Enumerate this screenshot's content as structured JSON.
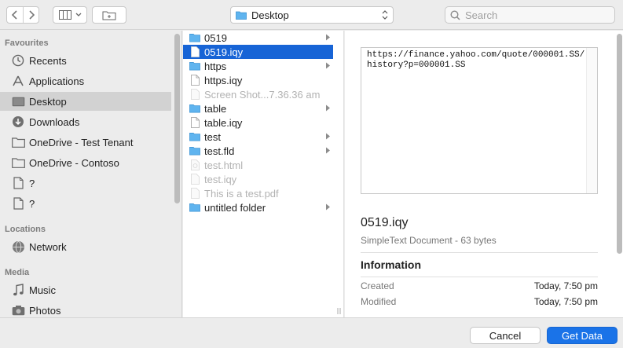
{
  "toolbar": {
    "location": "Desktop",
    "search_placeholder": "Search"
  },
  "sidebar": {
    "favourites_heading": "Favourites",
    "favourites": [
      {
        "label": "Recents",
        "icon": "clock-icon"
      },
      {
        "label": "Applications",
        "icon": "applications-icon"
      },
      {
        "label": "Desktop",
        "icon": "desktop-icon",
        "selected": true
      },
      {
        "label": "Downloads",
        "icon": "download-icon"
      },
      {
        "label": "OneDrive - Test Tenant",
        "icon": "folder-icon"
      },
      {
        "label": "OneDrive - Contoso",
        "icon": "folder-icon"
      },
      {
        "label": "?",
        "icon": "document-icon"
      },
      {
        "label": "?",
        "icon": "document-icon"
      }
    ],
    "locations_heading": "Locations",
    "locations": [
      {
        "label": "Network",
        "icon": "network-icon"
      }
    ],
    "media_heading": "Media",
    "media": [
      {
        "label": "Music",
        "icon": "music-icon"
      },
      {
        "label": "Photos",
        "icon": "camera-icon"
      }
    ]
  },
  "files": [
    {
      "name": "0519",
      "type": "folder",
      "enabled": true,
      "chevron": true
    },
    {
      "name": "0519.iqy",
      "type": "doc",
      "enabled": true,
      "selected": true
    },
    {
      "name": "https",
      "type": "folder",
      "enabled": true,
      "chevron": true
    },
    {
      "name": "https.iqy",
      "type": "doc",
      "enabled": true
    },
    {
      "name": "Screen Shot...7.36.36 am",
      "type": "doc",
      "enabled": false
    },
    {
      "name": "table",
      "type": "folder",
      "enabled": true,
      "chevron": true
    },
    {
      "name": "table.iqy",
      "type": "doc",
      "enabled": true
    },
    {
      "name": "test",
      "type": "folder",
      "enabled": true,
      "chevron": true
    },
    {
      "name": "test.fld",
      "type": "folder",
      "enabled": true,
      "chevron": true
    },
    {
      "name": "test.html",
      "type": "doc",
      "enabled": false
    },
    {
      "name": "test.iqy",
      "type": "doc",
      "enabled": false
    },
    {
      "name": "This is a test.pdf",
      "type": "doc",
      "enabled": false
    },
    {
      "name": "untitled folder",
      "type": "folder",
      "enabled": true,
      "chevron": true
    }
  ],
  "preview": {
    "content": "https://finance.yahoo.com/quote/000001.SS/history?p=000001.SS",
    "name": "0519.iqy",
    "kind": "SimpleText Document - 63 bytes",
    "info_heading": "Information",
    "created_label": "Created",
    "created_value": "Today, 7:50 pm",
    "modified_label": "Modified",
    "modified_value": "Today, 7:50 pm"
  },
  "buttons": {
    "cancel": "Cancel",
    "primary": "Get Data"
  },
  "colors": {
    "selection": "#1764d6",
    "folder": "#5fb4ef",
    "primary_button": "#1a73e8"
  }
}
